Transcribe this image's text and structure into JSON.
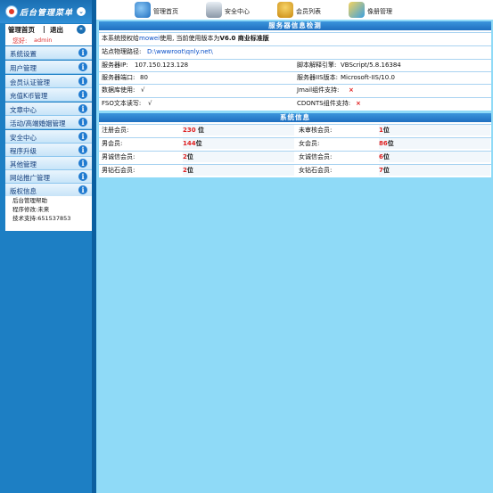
{
  "sidebar": {
    "title": "后台管理菜单",
    "top_links": {
      "home": "管理首页",
      "sep": "|",
      "quit": "退出",
      "arrows": "«"
    },
    "greeting": {
      "label": "您好:",
      "user": "admin"
    },
    "menu": [
      {
        "label": "系统设置"
      },
      {
        "label": "用户管理"
      },
      {
        "label": "会员认证管理"
      },
      {
        "label": "充值K币管理"
      },
      {
        "label": "文章中心"
      },
      {
        "label": "活动/高端婚姻管理"
      },
      {
        "label": "安全中心"
      },
      {
        "label": "程序升级"
      },
      {
        "label": "其他管理"
      },
      {
        "label": "网站推广管理"
      },
      {
        "label": "版权信息"
      }
    ],
    "info_icon": "i",
    "about": {
      "l1": "后台管理帮助",
      "l2": "程序修改:未来",
      "l3": "技术支持:651537853"
    }
  },
  "toolbar": {
    "items": [
      {
        "label": "管理首页",
        "icon": "home-icon",
        "color": "#2a7fd0"
      },
      {
        "label": "安全中心",
        "icon": "security-icon",
        "color": "#8a98a8"
      },
      {
        "label": "会员列表",
        "icon": "members-icon",
        "color": "#d7a21f"
      },
      {
        "label": "像册管理",
        "icon": "album-icon",
        "color": "#e0b22a"
      }
    ]
  },
  "server": {
    "title": "服务器信息检测",
    "license_pre": "本系统授权给",
    "license_user": "mowei",
    "license_mid": "使用, 当前使用版本为",
    "license_ver": "V6.0 商业标准版",
    "path_label": "站点物理路径:",
    "path_value": "D:\\wwwroot\\qnly.net\\",
    "ip_label": "服务器IP:",
    "ip_value": "107.150.123.128",
    "engine_label": "脚本解释引擎:",
    "engine_value": "VBScript/5.8.16384",
    "port_label": "服务器端口:",
    "port_value": "80",
    "iis_label": "服务器IIS版本:",
    "iis_value": "Microsoft-IIS/10.0",
    "db_label": "数据库使用:",
    "db_value": "√",
    "jmail_label": "Jmail组件支持:",
    "jmail_value": "×",
    "fso_label": "FSO文本读写:",
    "fso_value": "√",
    "cdonts_label": "CDONTS组件支持:",
    "cdonts_value": "×"
  },
  "stats": {
    "title": "系统信息",
    "rows": [
      {
        "l1": "注册会员:",
        "v1": "230",
        "u1": " 位",
        "l2": "未审核会员:",
        "v2": "1",
        "u2": "位"
      },
      {
        "l1": "男会员:",
        "v1": "144",
        "u1": "位",
        "l2": "女会员:",
        "v2": "86",
        "u2": "位"
      },
      {
        "l1": "男诚信会员:",
        "v1": "2",
        "u1": "位",
        "l2": "女诚信会员:",
        "v2": "6",
        "u2": "位"
      },
      {
        "l1": "男钻石会员:",
        "v1": "2",
        "u1": "位",
        "l2": "女钻石会员:",
        "v2": "7",
        "u2": "位"
      }
    ]
  }
}
